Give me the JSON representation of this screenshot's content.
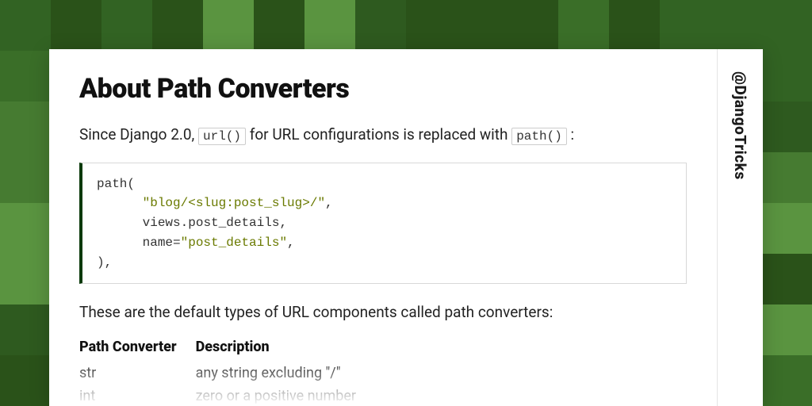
{
  "bg_palette": [
    "#2e5a1f",
    "#3a6e28",
    "#467b31",
    "#5a9440",
    "#2a5219",
    "#326323"
  ],
  "title": "About Path Converters",
  "handle": "@DjangoTricks",
  "intro": {
    "pre": "Since Django 2.0, ",
    "code1": "url()",
    "mid": " for URL configurations is replaced with ",
    "code2": "path()",
    "post": " :"
  },
  "code": {
    "l1_fn": "path",
    "l1_open": "(",
    "l2_str": "\"blog/<slug:post_slug>/\"",
    "l2_comma": ",",
    "l3_a": "views",
    "l3_dot": ".",
    "l3_b": "post_details",
    "l3_comma": ",",
    "l4_kw": "name",
    "l4_eq": "=",
    "l4_str": "\"post_details\"",
    "l4_comma": ",",
    "l5_close": "),"
  },
  "desc": "These are the default types of URL components called path converters:",
  "table": {
    "h1": "Path Converter",
    "h2": "Description",
    "rows": [
      {
        "c1": "str",
        "c2": "any string excluding \"/\""
      },
      {
        "c1": "int",
        "c2": "zero or a positive number"
      }
    ]
  }
}
